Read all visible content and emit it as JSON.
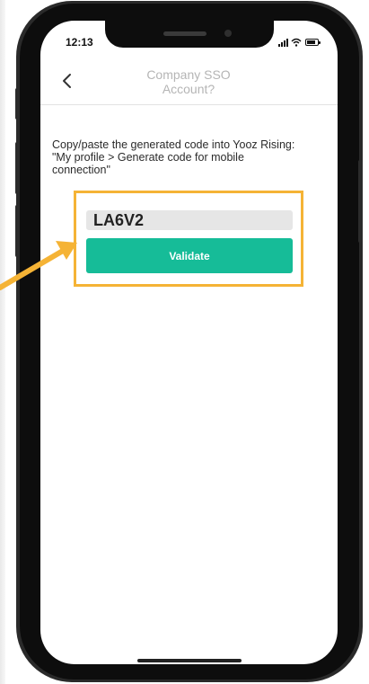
{
  "status_bar": {
    "time": "12:13"
  },
  "header": {
    "title_line1": "Company SSO",
    "title_line2": "Account?"
  },
  "content": {
    "instruction_line1": "Copy/paste the generated code into Yooz Rising:",
    "instruction_line2": "\"My profile > Generate code for mobile",
    "instruction_line3": "connection\""
  },
  "code_input": {
    "value": "LA6V2"
  },
  "validate_button": {
    "label": "Validate"
  },
  "colors": {
    "accent": "#16bc98",
    "highlight": "#f5b335",
    "header_text": "#b5b5b5"
  },
  "icons": {
    "back": "chevron-left-icon",
    "signal": "cellular-signal-icon",
    "wifi": "wifi-icon",
    "battery": "battery-icon",
    "pointer": "arrow-pointer-icon"
  }
}
